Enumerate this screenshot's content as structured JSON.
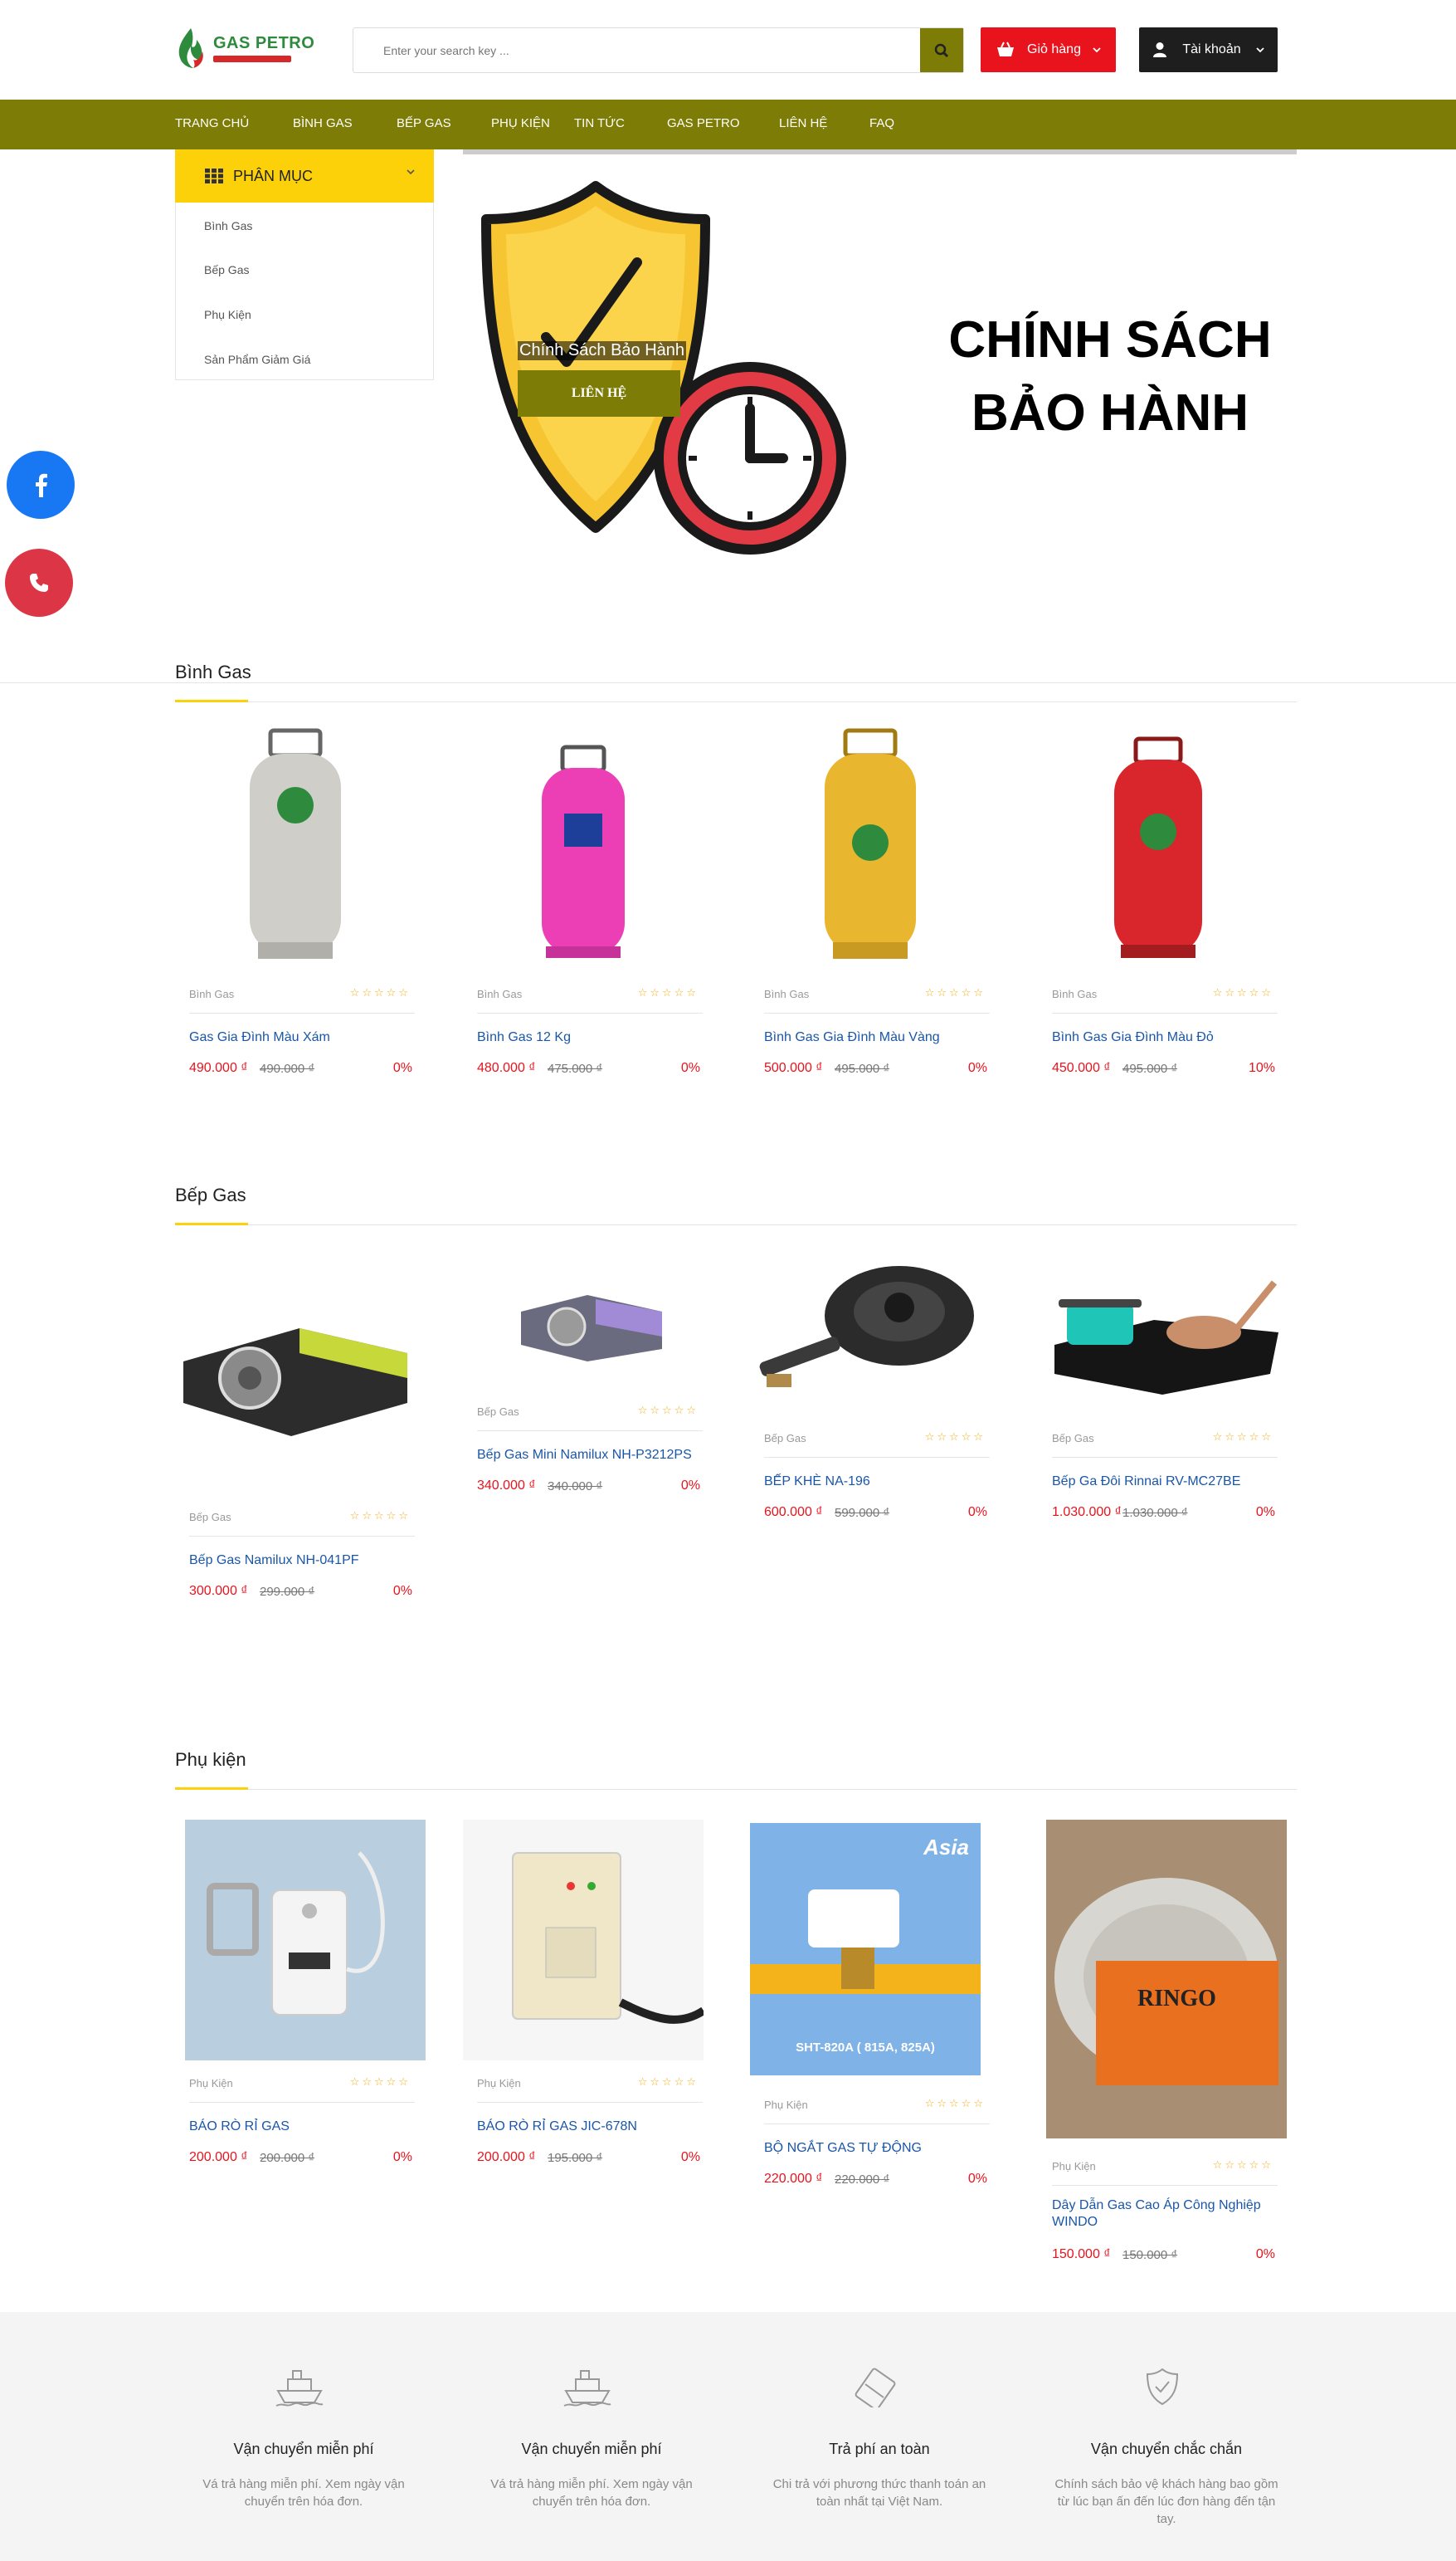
{
  "header": {
    "logo_text": "GAS PETRO",
    "search_placeholder": "Enter your search key ...",
    "cart_label": "Giỏ hàng",
    "account_label": "Tài khoản"
  },
  "nav": {
    "items": [
      "TRANG CHỦ",
      "BÌNH GAS",
      "BẾP GAS",
      "PHỤ KIỆN",
      "TIN TỨC",
      "GAS PETRO",
      "LIÊN HỆ",
      "FAQ"
    ]
  },
  "sidebar": {
    "title": "PHÂN MỤC",
    "items": [
      "Bình Gas",
      "Bếp Gas",
      "Phụ Kiện",
      "Sản Phẩm Giảm Giá"
    ]
  },
  "banner": {
    "headline_line1": "CHÍNH SÁCH",
    "headline_line2": "BẢO HÀNH",
    "caption": "Chính Sách Bảo Hành",
    "button": "LIÊN HỆ"
  },
  "sections": [
    {
      "title": "Bình Gas",
      "products": [
        {
          "category": "Bình Gas",
          "name": "Gas Gia Đình Màu Xám",
          "price": "490.000 ₫",
          "old_price": "490.000 ₫",
          "discount": "0%",
          "color": "#c9c8c2"
        },
        {
          "category": "Bình Gas",
          "name": "Bình Gas 12 Kg",
          "price": "480.000 ₫",
          "old_price": "475.000 ₫",
          "discount": "0%",
          "color": "#ec3fb6"
        },
        {
          "category": "Bình Gas",
          "name": "Bình Gas Gia Đình Màu Vàng",
          "price": "500.000 ₫",
          "old_price": "495.000 ₫",
          "discount": "0%",
          "color": "#e9b630"
        },
        {
          "category": "Bình Gas",
          "name": "Bình Gas Gia Đình Màu Đỏ",
          "price": "450.000 ₫",
          "old_price": "495.000 ₫",
          "discount": "10%",
          "color": "#d9262c"
        }
      ]
    },
    {
      "title": "Bếp Gas",
      "products": [
        {
          "category": "Bếp Gas",
          "name": "Bếp Gas Namilux NH-041PF",
          "price": "300.000 ₫",
          "old_price": "299.000 ₫",
          "discount": "0%"
        },
        {
          "category": "Bếp Gas",
          "name": "Bếp Gas Mini Namilux NH-P3212PS",
          "price": "340.000 ₫",
          "old_price": "340.000 ₫",
          "discount": "0%"
        },
        {
          "category": "Bếp Gas",
          "name": "BẾP KHÈ NA-196",
          "price": "600.000 ₫",
          "old_price": "599.000 ₫",
          "discount": "0%"
        },
        {
          "category": "Bếp Gas",
          "name": "Bếp Ga Đôi Rinnai RV-MC27BE",
          "price": "1.030.000 ₫",
          "old_price": "1.030.000 ₫",
          "discount": "0%"
        }
      ]
    },
    {
      "title": "Phụ kiện",
      "products": [
        {
          "category": "Phụ Kiện",
          "name": "BÁO RÒ RỈ GAS",
          "price": "200.000 ₫",
          "old_price": "200.000 ₫",
          "discount": "0%"
        },
        {
          "category": "Phụ Kiện",
          "name": "BÁO RÒ RỈ GAS JIC-678N",
          "price": "200.000 ₫",
          "old_price": "195.000 ₫",
          "discount": "0%"
        },
        {
          "category": "Phụ Kiện",
          "name": "BỘ NGẮT GAS TỰ ĐỘNG",
          "price": "220.000 ₫",
          "old_price": "220.000 ₫",
          "discount": "0%",
          "img_text": "SHT-820A ( 815A, 825A)",
          "img_brand": "Asia"
        },
        {
          "category": "Phụ Kiện",
          "name": "Dây Dẫn Gas Cao Áp Công Nghiệp WINDO",
          "price": "150.000 ₫",
          "old_price": "150.000 ₫",
          "discount": "0%",
          "img_brand": "RINGO"
        }
      ]
    }
  ],
  "footer": {
    "items": [
      {
        "title": "Vận chuyển miễn phí",
        "desc": "Vá trả hàng miễn phí. Xem ngày vận chuyển trên hóa đơn.",
        "icon": "ship-icon"
      },
      {
        "title": "Vận chuyển miễn phí",
        "desc": "Vá trả hàng miễn phí. Xem ngày vận chuyển trên hóa đơn.",
        "icon": "ship-icon"
      },
      {
        "title": "Trả phí an toàn",
        "desc": "Chi trả với phương thức thanh toán an toàn nhất tại Việt Nam.",
        "icon": "card-icon"
      },
      {
        "title": "Vận chuyển chắc chắn",
        "desc": "Chính sách bảo vệ khách hàng bao gồm từ lúc bạn ấn đến lúc đơn hàng đến tận tay.",
        "icon": "shield-check-icon"
      }
    ]
  },
  "rating_stars": "☆☆☆☆☆"
}
